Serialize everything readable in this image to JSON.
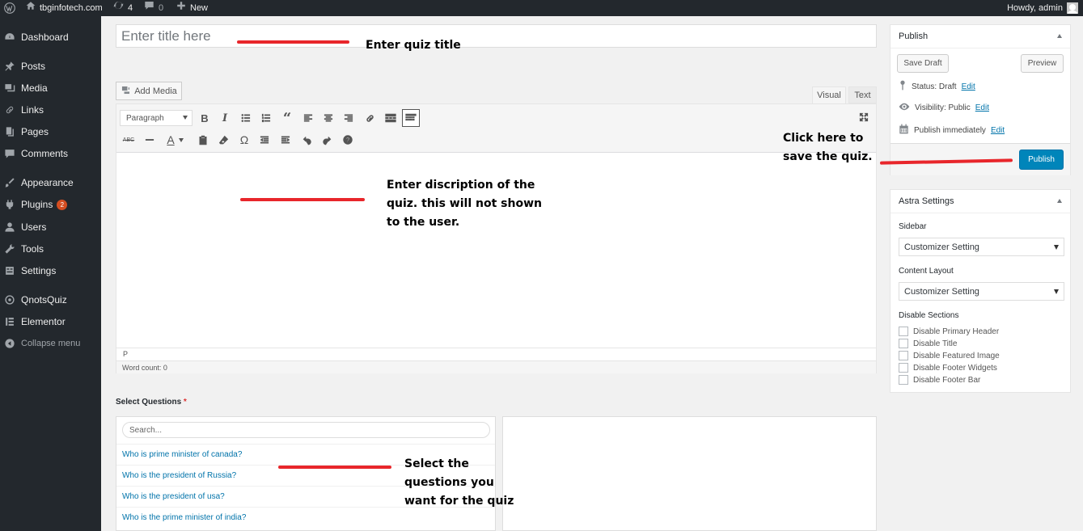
{
  "admin_bar": {
    "site_name": "tbginfotech.com",
    "updates_count": "4",
    "comments_count": "0",
    "new_label": "New",
    "howdy": "Howdy, admin"
  },
  "sidebar": {
    "items": [
      {
        "label": "Dashboard",
        "icon": "dashboard-icon"
      },
      {
        "label": "Posts",
        "icon": "pin-icon"
      },
      {
        "label": "Media",
        "icon": "media-icon"
      },
      {
        "label": "Links",
        "icon": "link-icon"
      },
      {
        "label": "Pages",
        "icon": "pages-icon"
      },
      {
        "label": "Comments",
        "icon": "comment-icon"
      },
      {
        "label": "Appearance",
        "icon": "brush-icon"
      },
      {
        "label": "Plugins",
        "icon": "plugin-icon",
        "badge": "2"
      },
      {
        "label": "Users",
        "icon": "user-icon"
      },
      {
        "label": "Tools",
        "icon": "wrench-icon"
      },
      {
        "label": "Settings",
        "icon": "settings-icon"
      },
      {
        "label": "QnotsQuiz",
        "icon": "quiz-icon"
      },
      {
        "label": "Elementor",
        "icon": "elementor-icon"
      },
      {
        "label": "Collapse menu",
        "icon": "collapse-icon"
      }
    ]
  },
  "title_field": {
    "placeholder": "Enter title here"
  },
  "annotations": {
    "title": "Enter quiz title",
    "description_line1": "Enter discription of the",
    "description_line2": "quiz. this will not shown",
    "description_line3": "to the user.",
    "save_line1": "Click here to",
    "save_line2": "save the quiz.",
    "questions_line1": "Select the",
    "questions_line2": "questions you",
    "questions_line3": "want for the quiz"
  },
  "editor": {
    "add_media_label": "Add Media",
    "tab_visual": "Visual",
    "tab_text": "Text",
    "format_select": "Paragraph",
    "path": "P",
    "word_count": "Word count: 0"
  },
  "questions": {
    "label": "Select Questions",
    "required_mark": "*",
    "search_placeholder": "Search...",
    "items": [
      "Who is prime minister of canada?",
      "Who is the president of Russia?",
      "Who is the president of usa?",
      "Who is the prime minister of india?"
    ]
  },
  "publish_box": {
    "title": "Publish",
    "save_draft": "Save Draft",
    "preview": "Preview",
    "status_label": "Status: Draft",
    "visibility_label": "Visibility: Public",
    "schedule_label": "Publish immediately",
    "edit_link": "Edit",
    "publish_button": "Publish"
  },
  "astra_box": {
    "title": "Astra Settings",
    "sidebar_label": "Sidebar",
    "sidebar_value": "Customizer Setting",
    "content_layout_label": "Content Layout",
    "content_layout_value": "Customizer Setting",
    "disable_sections_label": "Disable Sections",
    "checkboxes": [
      "Disable Primary Header",
      "Disable Title",
      "Disable Featured Image",
      "Disable Footer Widgets",
      "Disable Footer Bar"
    ]
  },
  "colors": {
    "admin_dark": "#23282d",
    "link_blue": "#0073aa",
    "publish_blue": "#0085ba",
    "annotation_red": "#e8262b"
  }
}
